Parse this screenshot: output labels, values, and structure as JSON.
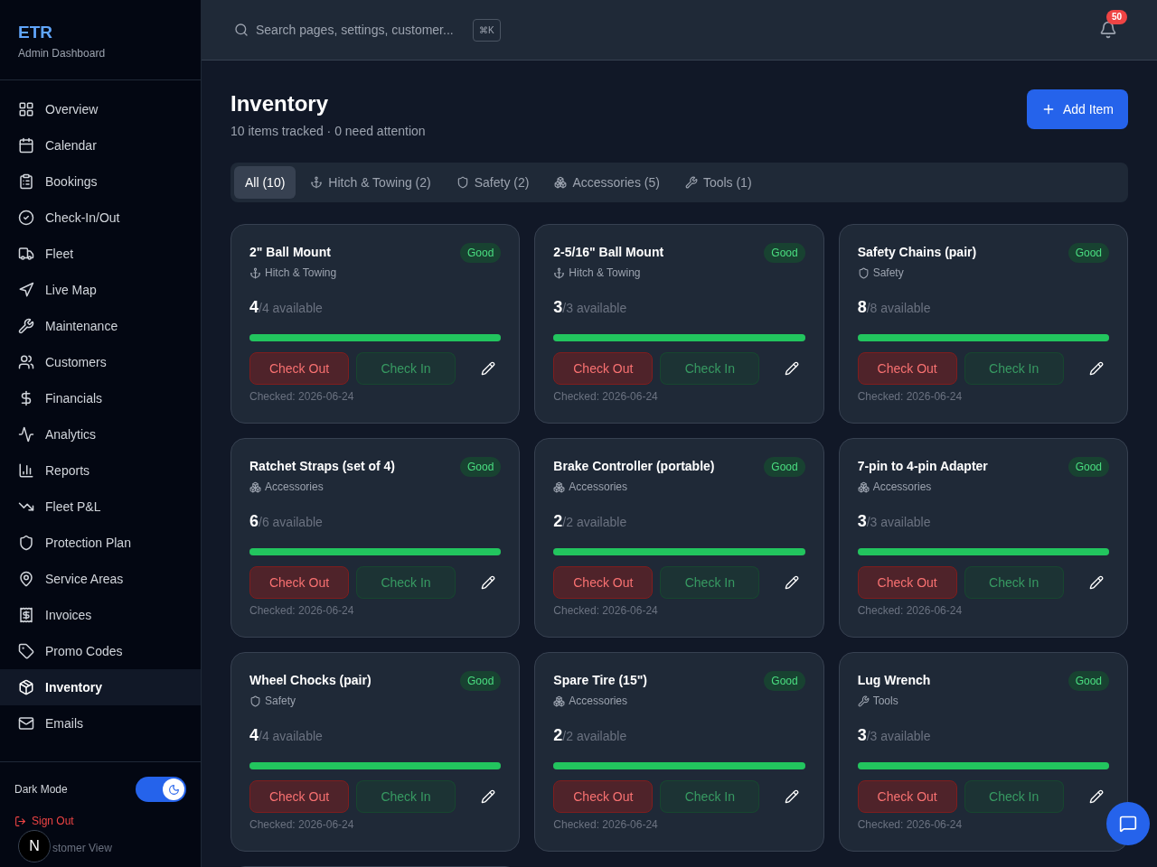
{
  "brand": {
    "title": "ETR",
    "subtitle": "Admin Dashboard"
  },
  "sidebar": {
    "items": [
      {
        "label": "Overview",
        "selected": false
      },
      {
        "label": "Calendar",
        "selected": false
      },
      {
        "label": "Bookings",
        "selected": false
      },
      {
        "label": "Check-In/Out",
        "selected": false
      },
      {
        "label": "Fleet",
        "selected": false
      },
      {
        "label": "Live Map",
        "selected": false
      },
      {
        "label": "Maintenance",
        "selected": false
      },
      {
        "label": "Customers",
        "selected": false
      },
      {
        "label": "Financials",
        "selected": false
      },
      {
        "label": "Analytics",
        "selected": false
      },
      {
        "label": "Reports",
        "selected": false
      },
      {
        "label": "Fleet P&L",
        "selected": false
      },
      {
        "label": "Protection Plan",
        "selected": false
      },
      {
        "label": "Service Areas",
        "selected": false
      },
      {
        "label": "Invoices",
        "selected": false
      },
      {
        "label": "Promo Codes",
        "selected": false
      },
      {
        "label": "Inventory",
        "selected": true
      },
      {
        "label": "Emails",
        "selected": false
      }
    ],
    "dark_mode": {
      "label": "Dark Mode",
      "on": true
    },
    "sign_out": "Sign Out",
    "customer_view": "stomer View",
    "dev_badge": "N"
  },
  "header": {
    "search": {
      "placeholder": "Search pages, settings, customer..."
    },
    "shortcut": "⌘K",
    "notifications": "50"
  },
  "page": {
    "title": "Inventory",
    "subtitle": "10 items tracked · 0 need attention",
    "add_button": "Add Item"
  },
  "tabs": [
    {
      "label": "All (10)",
      "selected": true
    },
    {
      "label": "Hitch & Towing (2)",
      "kind": "hitch",
      "selected": false
    },
    {
      "label": "Safety (2)",
      "kind": "safety",
      "selected": false
    },
    {
      "label": "Accessories (5)",
      "kind": "accessories",
      "selected": false
    },
    {
      "label": "Tools (1)",
      "kind": "tools",
      "selected": false
    }
  ],
  "items": [
    {
      "name": "2\" Ball Mount",
      "kind": "hitch",
      "category": "Hitch & Towing",
      "status": "Good",
      "available": "4",
      "total": "/4 available",
      "level": 1,
      "check_out": "Check Out",
      "check_in": "Check In",
      "checked": "Checked: 2026-06-24"
    },
    {
      "name": "2-5/16\" Ball Mount",
      "kind": "hitch",
      "category": "Hitch & Towing",
      "status": "Good",
      "available": "3",
      "total": "/3 available",
      "level": 1,
      "check_out": "Check Out",
      "check_in": "Check In",
      "checked": "Checked: 2026-06-24"
    },
    {
      "name": "Safety Chains (pair)",
      "kind": "safety",
      "category": "Safety",
      "status": "Good",
      "available": "8",
      "total": "/8 available",
      "level": 1,
      "check_out": "Check Out",
      "check_in": "Check In",
      "checked": "Checked: 2026-06-24"
    },
    {
      "name": "Ratchet Straps (set of 4)",
      "kind": "accessories",
      "category": "Accessories",
      "status": "Good",
      "available": "6",
      "total": "/6 available",
      "level": 1,
      "check_out": "Check Out",
      "check_in": "Check In",
      "checked": "Checked: 2026-06-24"
    },
    {
      "name": "Brake Controller (portable)",
      "kind": "accessories",
      "category": "Accessories",
      "status": "Good",
      "available": "2",
      "total": "/2 available",
      "level": 1,
      "check_out": "Check Out",
      "check_in": "Check In",
      "checked": "Checked: 2026-06-24"
    },
    {
      "name": "7-pin to 4-pin Adapter",
      "kind": "accessories",
      "category": "Accessories",
      "status": "Good",
      "available": "3",
      "total": "/3 available",
      "level": 1,
      "check_out": "Check Out",
      "check_in": "Check In",
      "checked": "Checked: 2026-06-24"
    },
    {
      "name": "Wheel Chocks (pair)",
      "kind": "safety",
      "category": "Safety",
      "status": "Good",
      "available": "4",
      "total": "/4 available",
      "level": 1,
      "check_out": "Check Out",
      "check_in": "Check In",
      "checked": "Checked: 2026-06-24"
    },
    {
      "name": "Spare Tire (15\")",
      "kind": "accessories",
      "category": "Accessories",
      "status": "Good",
      "available": "2",
      "total": "/2 available",
      "level": 1,
      "check_out": "Check Out",
      "check_in": "Check In",
      "checked": "Checked: 2026-06-24"
    },
    {
      "name": "Lug Wrench",
      "kind": "tools",
      "category": "Tools",
      "status": "Good",
      "available": "3",
      "total": "/3 available",
      "level": 1,
      "check_out": "Check Out",
      "check_in": "Check In",
      "checked": "Checked: 2026-06-24"
    }
  ]
}
